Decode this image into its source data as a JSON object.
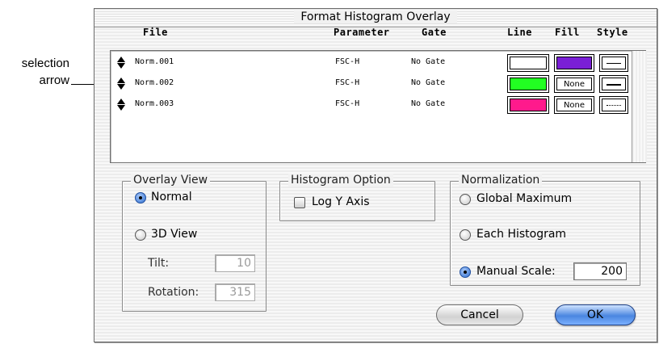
{
  "callout": {
    "line1": "selection",
    "line2": "arrow"
  },
  "dialog": {
    "title": "Format Histogram Overlay"
  },
  "columns": {
    "file": "File",
    "parameter": "Parameter",
    "gate": "Gate",
    "line": "Line",
    "fill": "Fill",
    "style": "Style"
  },
  "rows": [
    {
      "file": "Norm.001",
      "parameter": "FSC-H",
      "gate": "No Gate",
      "line_color": "#ffffff",
      "fill_color": "#7a1fd6",
      "fill_label": "",
      "style": "thin"
    },
    {
      "file": "Norm.002",
      "parameter": "FSC-H",
      "gate": "No Gate",
      "line_color": "#22ff22",
      "fill_color": "",
      "fill_label": "None",
      "style": "thick"
    },
    {
      "file": "Norm.003",
      "parameter": "FSC-H",
      "gate": "No Gate",
      "line_color": "#ff1a8c",
      "fill_color": "",
      "fill_label": "None",
      "style": "dotted"
    }
  ],
  "overlay_view": {
    "legend": "Overlay View",
    "normal": "Normal",
    "view3d": "3D View",
    "selected": "Normal",
    "tilt_label": "Tilt:",
    "tilt_value": "10",
    "rotation_label": "Rotation:",
    "rotation_value": "315"
  },
  "histogram_option": {
    "legend": "Histogram Option",
    "log_y": "Log Y Axis",
    "log_y_checked": false
  },
  "normalization": {
    "legend": "Normalization",
    "global_max": "Global Maximum",
    "each": "Each Histogram",
    "manual": "Manual Scale:",
    "selected": "Manual Scale:",
    "manual_value": "200"
  },
  "buttons": {
    "cancel": "Cancel",
    "ok": "OK"
  }
}
